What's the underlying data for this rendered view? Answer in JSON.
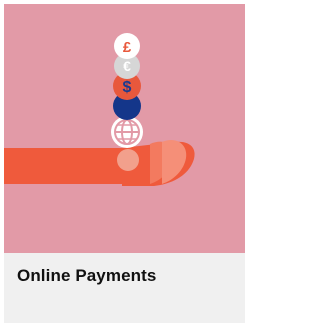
{
  "card": {
    "title": "Online Payments"
  },
  "illustration": {
    "background_color": "#e29aa7",
    "coins": [
      {
        "name": "pound-coin-icon",
        "symbol": "£",
        "fill": "#ffffff",
        "symbol_color": "#e8583c"
      },
      {
        "name": "euro-coin-icon",
        "symbol": "€",
        "fill": "#d6d6d6",
        "symbol_color": "#ffffff"
      },
      {
        "name": "dollar-coin-icon",
        "symbol": "$",
        "fill": "#e8583c",
        "symbol_color": "#1a3a8f"
      },
      {
        "name": "navy-coin-icon",
        "symbol": "",
        "fill": "#14368a",
        "symbol_color": "#ffffff"
      },
      {
        "name": "globe-coin-icon",
        "symbol": "",
        "fill": "#ffffff",
        "symbol_color": "#e29aa7"
      }
    ],
    "hand_color": "#ef5a3c",
    "finger_color": "#f2a08c"
  }
}
